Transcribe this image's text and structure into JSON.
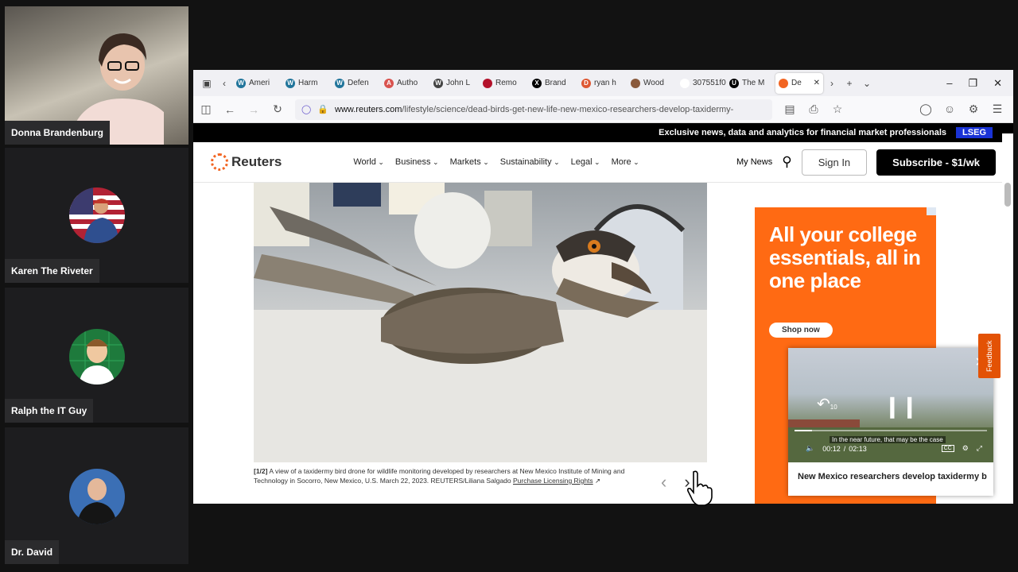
{
  "participants": [
    {
      "name": "Donna Brandenburg"
    },
    {
      "name": "Karen The Riveter"
    },
    {
      "name": "Ralph the IT Guy"
    },
    {
      "name": "Dr. David"
    }
  ],
  "browser": {
    "tabs": [
      {
        "label": "Ameri",
        "icon": "wordpress-icon",
        "color": "#21759b",
        "glyph": "W"
      },
      {
        "label": "Harm",
        "icon": "wordpress-icon",
        "color": "#21759b",
        "glyph": "W"
      },
      {
        "label": "Defen",
        "icon": "wordpress-icon",
        "color": "#21759b",
        "glyph": "W"
      },
      {
        "label": "Autho",
        "icon": "document-icon",
        "color": "#d9534f",
        "glyph": "A"
      },
      {
        "label": "John L",
        "icon": "w-letter-icon",
        "color": "#444444",
        "glyph": "W"
      },
      {
        "label": "Remo",
        "icon": "circle-icon",
        "color": "#b3122b",
        "glyph": ""
      },
      {
        "label": "Brand",
        "icon": "x-icon",
        "color": "#000000",
        "glyph": "X"
      },
      {
        "label": "ryan h",
        "icon": "duckduckgo-icon",
        "color": "#de5833",
        "glyph": "D"
      },
      {
        "label": "Wood",
        "icon": "photo-icon",
        "color": "#8a5a3c",
        "glyph": ""
      },
      {
        "label": "307551f0",
        "icon": "blank-icon",
        "color": "#ffffff",
        "glyph": ""
      },
      {
        "label": "The M",
        "icon": "u-letter-icon",
        "color": "#000000",
        "glyph": "U"
      },
      {
        "label": "De",
        "icon": "reuters-icon",
        "color": "#f26522",
        "glyph": ""
      }
    ],
    "url_domain": "www.reuters.com",
    "url_path": "/lifestyle/science/dead-birds-get-new-life-new-mexico-researchers-develop-taxidermy-"
  },
  "site": {
    "banner_text": "Exclusive news, data and analytics for financial market professionals",
    "banner_brand": "LSEG",
    "logo": "Reuters",
    "menu": [
      "World",
      "Business",
      "Markets",
      "Sustainability",
      "Legal",
      "More"
    ],
    "my_news": "My News",
    "sign_in": "Sign In",
    "subscribe": "Subscribe - $1/wk"
  },
  "article": {
    "caption_counter": "[1/2]",
    "caption": "A view of a taxidermy bird drone for wildlife monitoring developed by researchers at New Mexico Institute of Mining and Technology in Socorro, New Mexico, U.S. March 22, 2023. REUTERS/Liliana Salgado",
    "licensing": "Purchase Licensing Rights"
  },
  "ad": {
    "headline": "All your college essentials, all in one place",
    "cta": "Shop now"
  },
  "feedback": "Feedback",
  "video": {
    "rewind_label": "10",
    "subtitle": "In the near future, that may be the case",
    "current_time": "00:12",
    "separator": "/",
    "duration": "02:13",
    "progress": 0.09,
    "cc": "CC",
    "title": "New Mexico researchers develop taxidermy b"
  },
  "colors": {
    "reuters_orange": "#f26522",
    "ad_orange": "#ff6a13",
    "lseg_blue": "#1a33d6"
  }
}
